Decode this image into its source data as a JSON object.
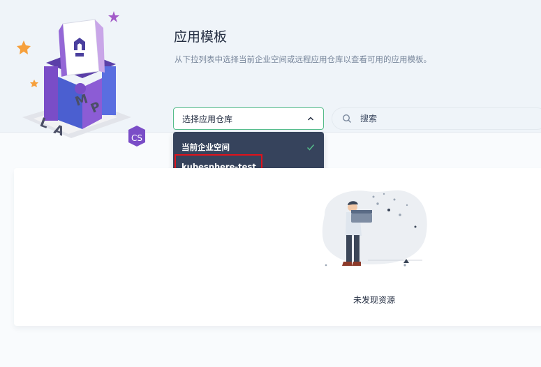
{
  "header": {
    "title": "应用模板",
    "description": "从下拉列表中选择当前企业空间或远程应用仓库以查看可用的应用模板。"
  },
  "banner": {
    "logo_letters": "LAMP",
    "badge_letters": "CS"
  },
  "repo_select": {
    "placeholder": "选择应用仓库",
    "options": [
      {
        "label": "当前企业空间",
        "selected": true
      },
      {
        "label": "kubesphere-test",
        "selected": false
      }
    ]
  },
  "search": {
    "placeholder": "搜索"
  },
  "empty_state": {
    "text": "未发现资源"
  },
  "colors": {
    "accent_green": "#55bc8a",
    "dropdown_bg": "#36435c",
    "highlight_red": "#e0121b"
  }
}
